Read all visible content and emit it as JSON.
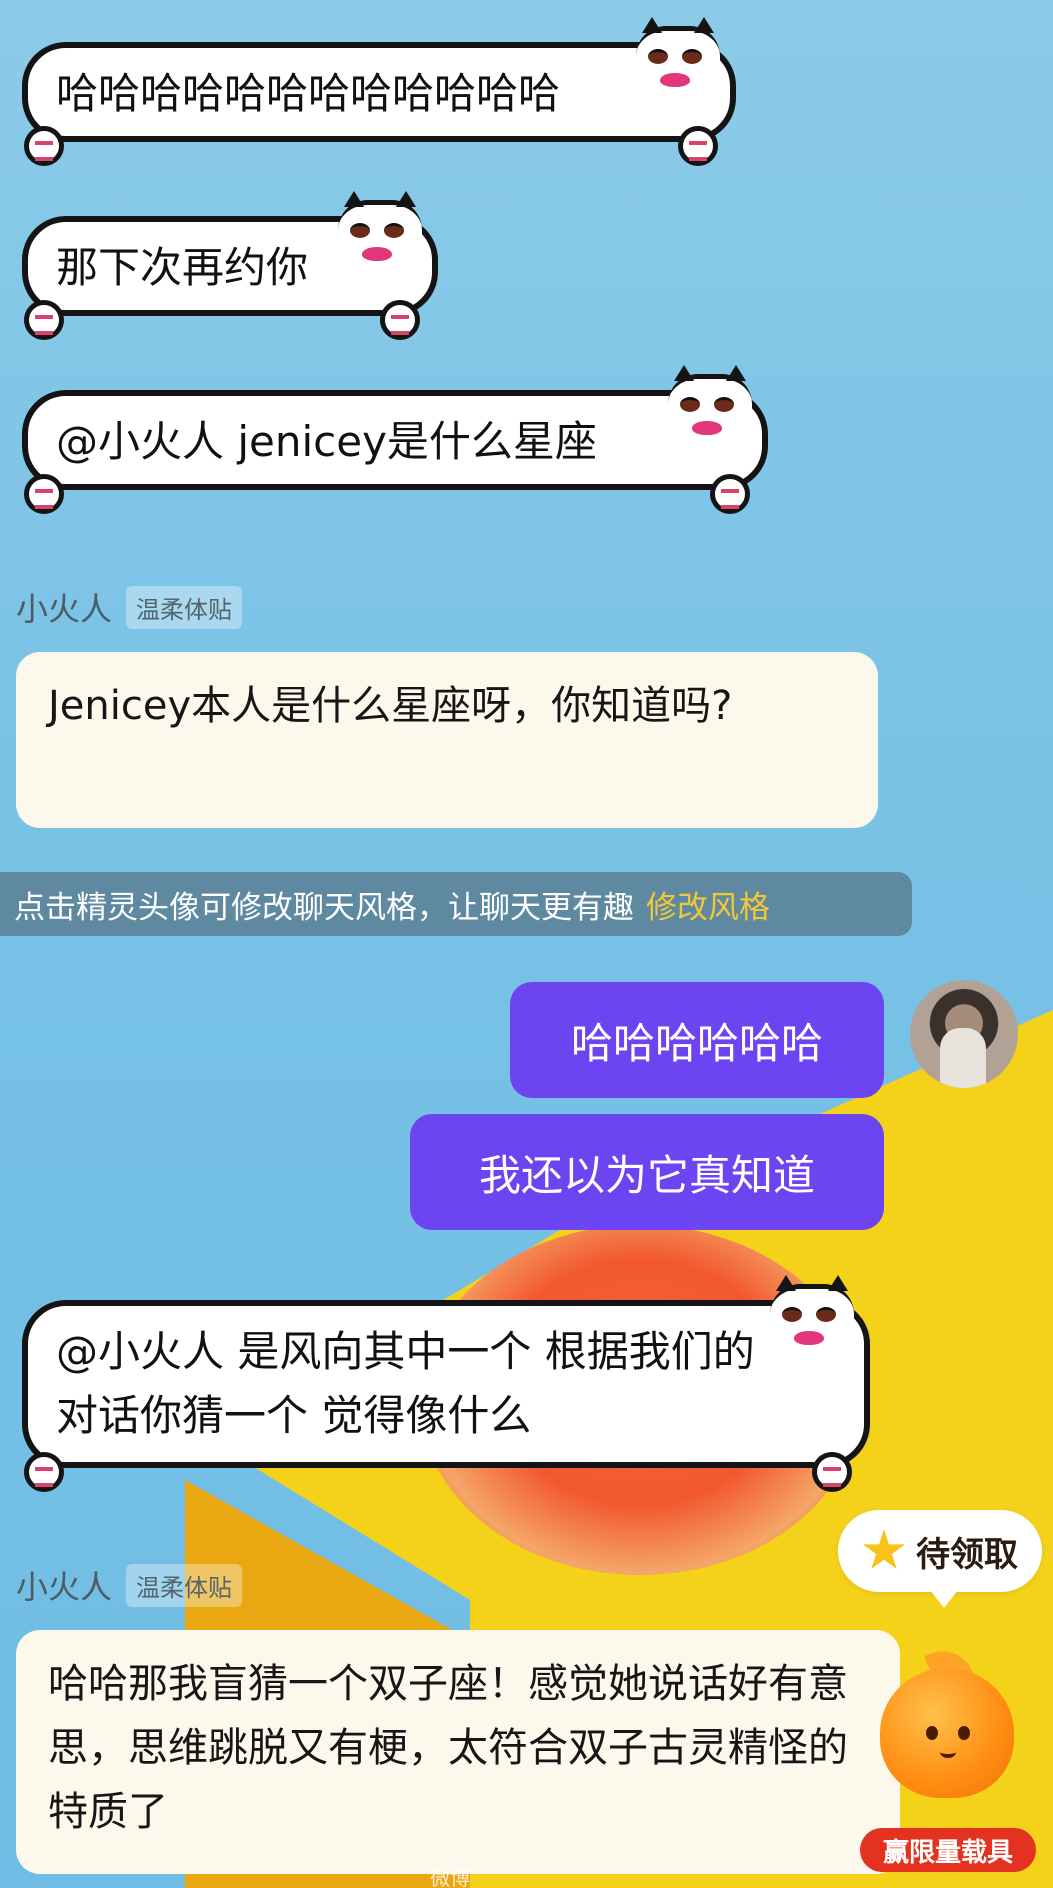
{
  "messages": {
    "u1": "哈哈哈哈哈哈哈哈哈哈哈哈",
    "u2": "那下次再约你",
    "u3": "@小火人 jenicey是什么星座",
    "bot1_name": "小火人",
    "bot1_tag": "温柔体贴",
    "bot1_reply": "Jenicey本人是什么星座呀，你知道吗?",
    "hint": "点击精灵头像可修改聊天风格，让聊天更有趣",
    "hint_link": "修改风格",
    "me1": "哈哈哈哈哈哈",
    "me2": "我还以为它真知道",
    "u4": "@小火人 是风向其中一个 根据我们的对话你猜一个 觉得像什么",
    "bot2_name": "小火人",
    "bot2_tag": "温柔体贴",
    "bot2_reply": "哈哈那我盲猜一个双子座！感觉她说话好有意思，思维跳脱又有梗，太符合双子古灵精怪的特质了"
  },
  "reward": {
    "label": "待领取",
    "icon": "star-icon"
  },
  "mascot": {
    "badge": "赢限量载具",
    "icon": "fire-mascot-icon"
  },
  "watermark": "微博"
}
